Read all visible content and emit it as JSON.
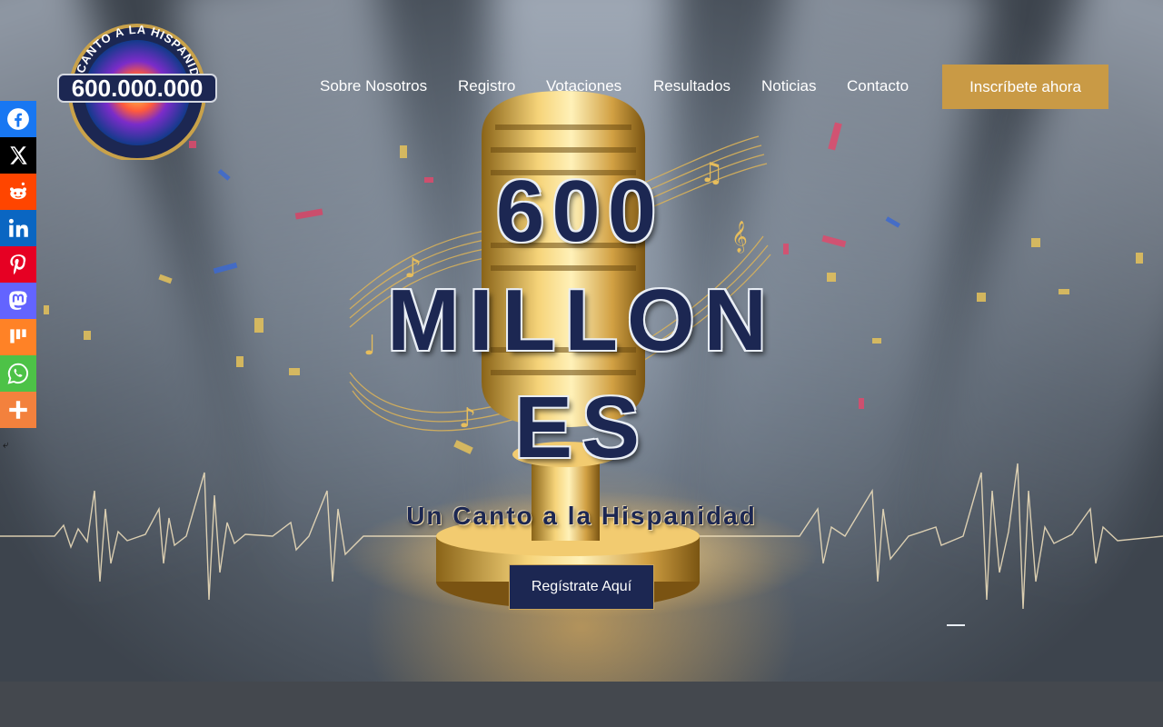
{
  "logo": {
    "arc_text": "UN CANTO A LA HISPANIDAD",
    "number": "600.000.000"
  },
  "nav": {
    "items": [
      {
        "label": "Sobre Nosotros"
      },
      {
        "label": "Registro"
      },
      {
        "label": "Votaciones"
      },
      {
        "label": "Resultados"
      },
      {
        "label": "Noticias"
      },
      {
        "label": "Contacto"
      }
    ],
    "cta": "Inscríbete ahora"
  },
  "hero": {
    "line1": "600",
    "line2": "MILLON",
    "line3": "ES",
    "subtitle": "Un Canto a la Hispanidad",
    "button": "Regístrate Aquí"
  },
  "social": {
    "items": [
      {
        "name": "facebook-icon",
        "color": "#1877f2"
      },
      {
        "name": "x-icon",
        "color": "#000000"
      },
      {
        "name": "reddit-icon",
        "color": "#ff4500"
      },
      {
        "name": "linkedin-icon",
        "color": "#0a66c2"
      },
      {
        "name": "pinterest-icon",
        "color": "#e60023"
      },
      {
        "name": "mastodon-icon",
        "color": "#6364ff"
      },
      {
        "name": "mix-icon",
        "color": "#ff8226"
      },
      {
        "name": "whatsapp-icon",
        "color": "#4dc247"
      },
      {
        "name": "more-icon",
        "color": "#f3813d"
      }
    ]
  },
  "colors": {
    "navy": "#1c2752",
    "gold": "#c99a45"
  }
}
